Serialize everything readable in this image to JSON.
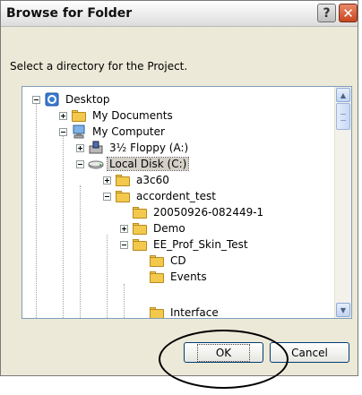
{
  "window": {
    "title": "Browse for Folder"
  },
  "titlebar": {
    "help_label": "?",
    "close_label": "✕"
  },
  "instructions": "Select a directory for the Project.",
  "tree": {
    "items": [
      {
        "label": "Desktop",
        "icon": "desktop-icon"
      },
      {
        "label": "My Documents",
        "icon": "folder-icon"
      },
      {
        "label": "My Computer",
        "icon": "computer-icon"
      },
      {
        "label": "3½ Floppy (A:)",
        "icon": "floppy-icon"
      },
      {
        "label": "Local Disk (C:)",
        "icon": "disk-icon",
        "selected": true
      },
      {
        "label": "a3c60",
        "icon": "folder-icon"
      },
      {
        "label": "accordent_test",
        "icon": "folder-icon"
      },
      {
        "label": "20050926-082449-1",
        "icon": "folder-icon"
      },
      {
        "label": "Demo",
        "icon": "folder-icon"
      },
      {
        "label": "EE_Prof_Skin_Test",
        "icon": "folder-icon"
      },
      {
        "label": "CD",
        "icon": "folder-icon"
      },
      {
        "label": "Events",
        "icon": "folder-icon"
      },
      {
        "label": "Interface",
        "icon": "folder-icon"
      }
    ]
  },
  "buttons": {
    "ok": "OK",
    "cancel": "Cancel"
  }
}
